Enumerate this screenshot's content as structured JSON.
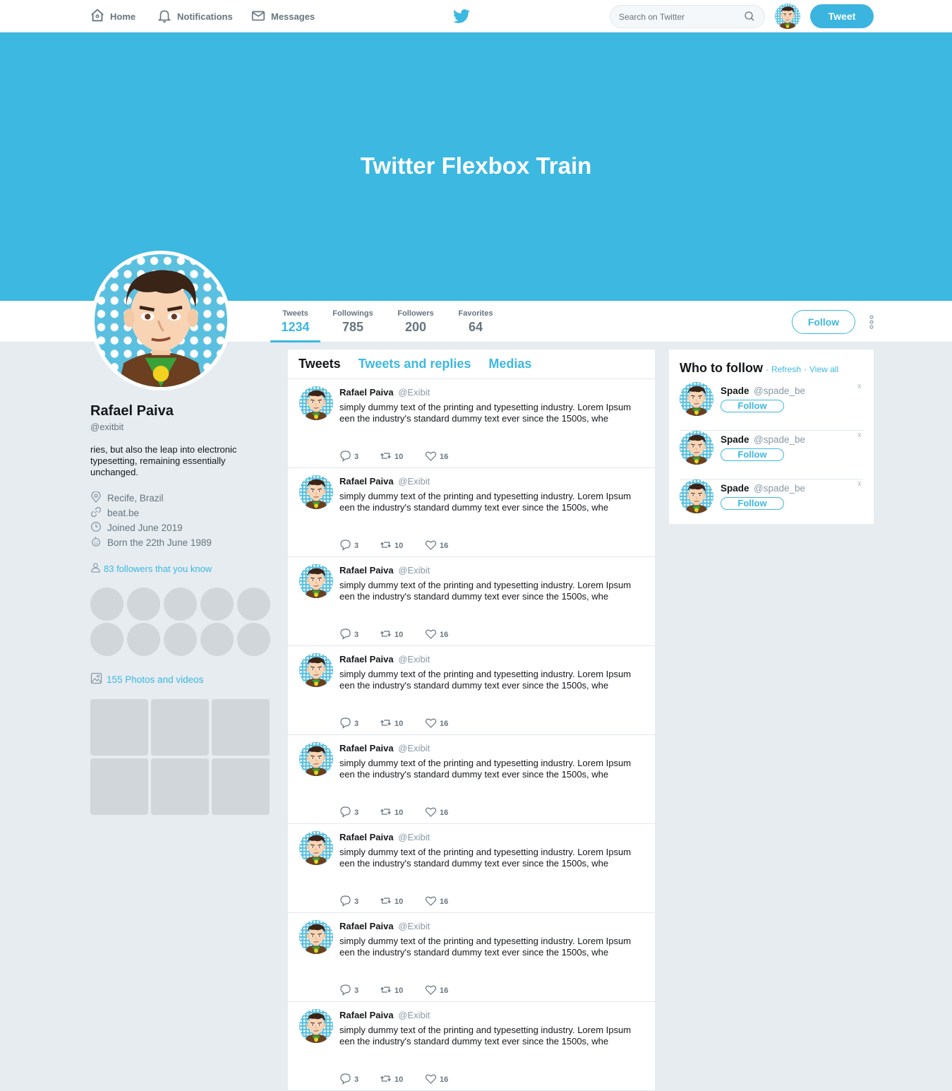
{
  "nav": {
    "home": "Home",
    "notifications": "Notifications",
    "messages": "Messages",
    "search_placeholder": "Search on Twitter",
    "tweet_button": "Tweet"
  },
  "banner": {
    "title": "Twitter Flexbox Train"
  },
  "stats": {
    "tweets_label": "Tweets",
    "tweets_value": "1234",
    "followings_label": "Followings",
    "followings_value": "785",
    "followers_label": "Followers",
    "followers_value": "200",
    "favorites_label": "Favorites",
    "favorites_value": "64",
    "follow_button": "Follow"
  },
  "profile": {
    "name": "Rafael Paiva",
    "handle": "@exitbit",
    "bio": "ries, but also the leap into electronic typesetting, remaining essentially unchanged.",
    "location": "Recife, Brazil",
    "website": "beat.be",
    "joined": "Joined June 2019",
    "born": "Born the 22th June 1989",
    "followers_you_know": "83 followers that you know",
    "photos_videos": "155 Photos and videos"
  },
  "timeline": {
    "tabs": [
      "Tweets",
      "Tweets and replies",
      "Medias"
    ],
    "tweet": {
      "name": "Rafael Paiva",
      "handle": "@Exibit",
      "text": "simply dummy text of the printing and typesetting industry. Lorem Ipsum een the industry's standard dummy text ever since the 1500s, whe",
      "replies": "3",
      "retweets": "10",
      "likes": "16"
    },
    "tweet_count_visible": 8
  },
  "who_to_follow": {
    "title": "Who to follow",
    "refresh": "Refresh",
    "separator": "·",
    "view_all": "View all",
    "users": [
      {
        "name": "Spade",
        "handle": "@spade_be",
        "follow": "Follow",
        "close": "x"
      },
      {
        "name": "Spade",
        "handle": "@spade_be",
        "follow": "Follow",
        "close": "x"
      },
      {
        "name": "Spade",
        "handle": "@spade_be",
        "follow": "Follow",
        "close": "x"
      }
    ]
  },
  "colors": {
    "accent": "#3cb8e1",
    "background": "#e6ecf0",
    "placeholder_gray": "#d1d6da"
  },
  "icons": [
    "home-icon",
    "bell-icon",
    "mail-icon",
    "twitter-bird-icon",
    "search-icon",
    "location-icon",
    "link-icon",
    "calendar-icon",
    "birthday-icon",
    "person-icon",
    "image-icon",
    "reply-icon",
    "retweet-icon",
    "heart-icon",
    "more-dots-icon"
  ]
}
